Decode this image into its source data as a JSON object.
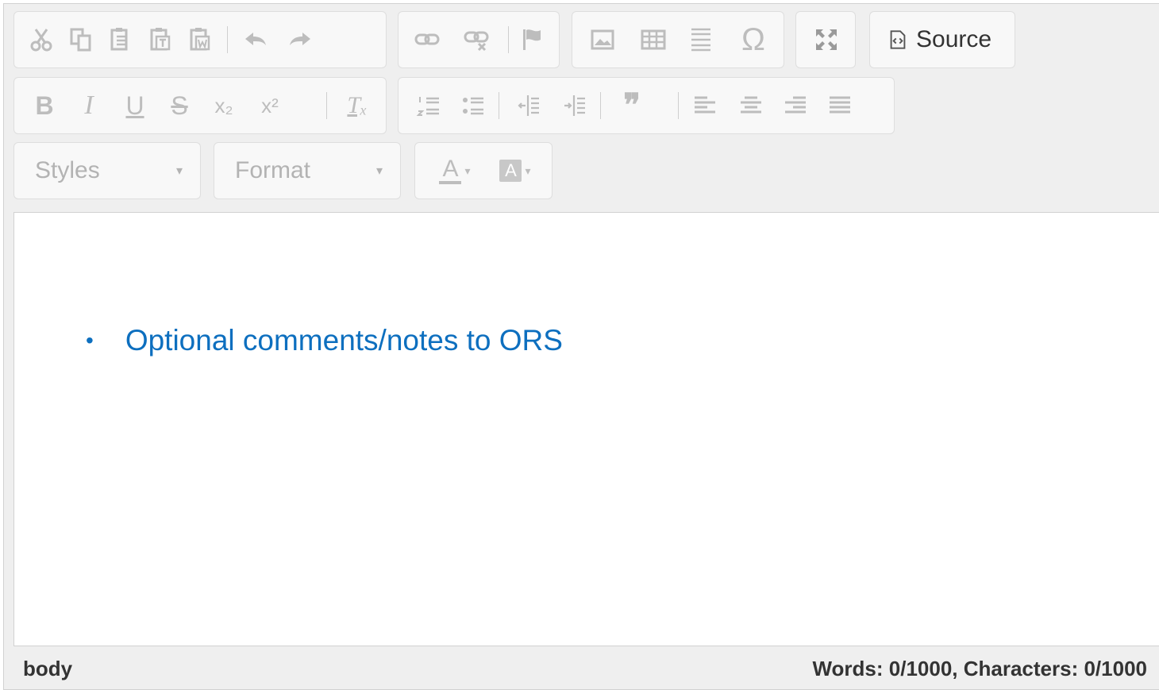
{
  "toolbar": {
    "clipboard": {
      "cut": "cut-icon",
      "copy": "copy-icon",
      "paste": "paste-icon",
      "paste_text": "paste-text-icon",
      "paste_word": "paste-word-icon",
      "undo": "undo-icon",
      "redo": "redo-icon"
    },
    "links": {
      "link": "link-icon",
      "unlink": "unlink-icon",
      "anchor": "anchor-flag-icon"
    },
    "insert": {
      "image": "image-icon",
      "table": "table-icon",
      "hr": "horizontal-line-icon",
      "special_char": "Ω"
    },
    "maximize": "maximize-icon",
    "source_label": "Source",
    "basicstyles": {
      "bold": "B",
      "italic": "I",
      "underline": "U",
      "strike": "S",
      "subscript": "x₂",
      "superscript": "x²",
      "remove_format": "Tₓ"
    },
    "paragraph": {
      "numbered_list": "numbered-list-icon",
      "bulleted_list": "bulleted-list-icon",
      "outdent": "outdent-icon",
      "indent": "indent-icon",
      "blockquote": "❞",
      "align_left": "align-left-icon",
      "align_center": "align-center-icon",
      "align_right": "align-right-icon",
      "justify": "justify-icon"
    },
    "styles_label": "Styles",
    "format_label": "Format",
    "text_color": "A",
    "bg_color": "A"
  },
  "content": {
    "bullets": [
      "Optional comments/notes to ORS"
    ]
  },
  "status": {
    "path": "body",
    "counter": "Words: 0/1000, Characters: 0/1000"
  },
  "colors": {
    "toolbar_bg": "#efefef",
    "icon_disabled": "#bdbdbd",
    "text_blue": "#0d6fbf"
  }
}
